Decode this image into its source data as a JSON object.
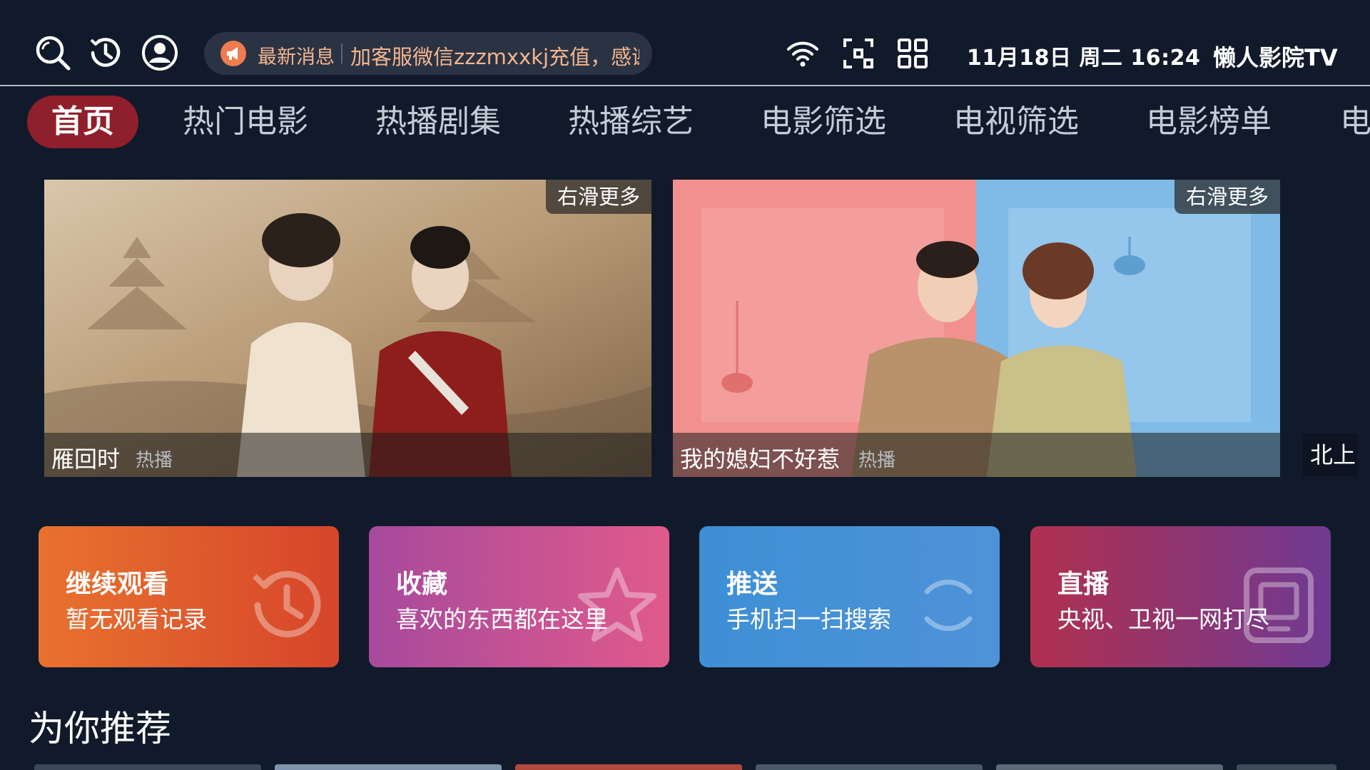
{
  "header": {
    "notice_label": "最新消息",
    "notice_text": "加客服微信zzzmxxkj充值，感谢",
    "clock": "11月18日 周二 16:24",
    "brand": "懒人影院TV",
    "icons": [
      "search-icon",
      "history-icon",
      "user-icon",
      "megaphone-icon",
      "wifi-icon",
      "scan-icon",
      "apps-grid-icon"
    ]
  },
  "tabs": [
    {
      "label": "首页",
      "active": true
    },
    {
      "label": "热门电影"
    },
    {
      "label": "热播剧集"
    },
    {
      "label": "热播综艺"
    },
    {
      "label": "电影筛选"
    },
    {
      "label": "电视筛选"
    },
    {
      "label": "电影榜单"
    },
    {
      "label": "电"
    }
  ],
  "banners": [
    {
      "title": "雁回时",
      "tag": "热播",
      "badge": "右滑更多"
    },
    {
      "title": "我的媳妇不好惹",
      "tag": "热播",
      "badge": "右滑更多"
    }
  ],
  "banner_peek": "北上",
  "cards": [
    {
      "title": "继续观看",
      "subtitle": "暂无观看记录",
      "icon": "history-icon",
      "gradient": [
        "#e8722f",
        "#d6452a"
      ]
    },
    {
      "title": "收藏",
      "subtitle": "喜欢的东西都在这里",
      "icon": "star-icon",
      "gradient": [
        "#a74a9c",
        "#e05a8c"
      ]
    },
    {
      "title": "推送",
      "subtitle": "手机扫一扫搜索",
      "icon": "push-icon",
      "gradient": [
        "#3d8fd6",
        "#4f92d8"
      ]
    },
    {
      "title": "直播",
      "subtitle": "央视、卫视一网打尽",
      "icon": "tv-icon",
      "gradient": [
        "#b0304f",
        "#6f3a92"
      ]
    }
  ],
  "section": {
    "title": "为你推荐"
  },
  "colors": {
    "background": "#111a2a",
    "active_tab": "#8f1f2a",
    "notice_text": "#f4b58e"
  }
}
